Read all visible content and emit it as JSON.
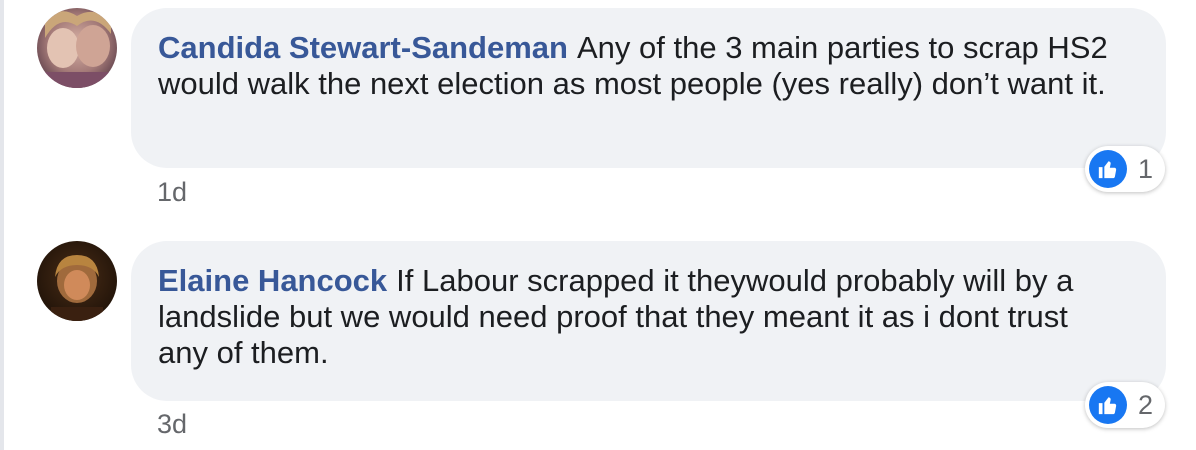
{
  "comments": [
    {
      "author": "Candida Stewart-Sandeman",
      "text": "Any of the 3 main parties to scrap HS2 would walk the next election as most people (yes really) don’t want it.",
      "time": "1d",
      "reaction_count": "1",
      "reaction_icon": "like-icon"
    },
    {
      "author": "Elaine Hancock",
      "text": "If Labour scrapped it theywould probably will by a landslide but we would need proof that they meant it as i dont trust any of them.",
      "time": "3d",
      "reaction_count": "2",
      "reaction_icon": "like-icon"
    }
  ],
  "colors": {
    "author": "#385898",
    "bubble": "#f0f2f5",
    "like": "#1877f2",
    "meta": "#65676b"
  }
}
